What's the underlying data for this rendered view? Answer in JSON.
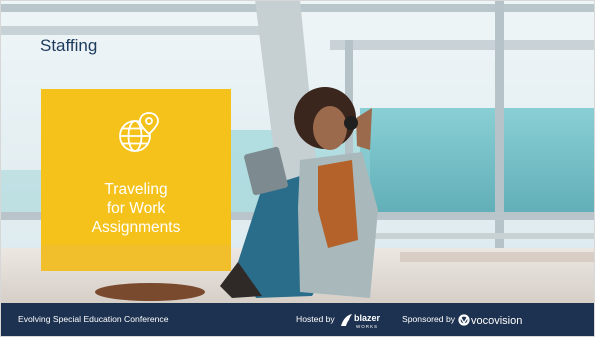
{
  "slide": {
    "title": "Staffing",
    "card": {
      "icon": "globe-location-pin-icon",
      "lines": [
        "Traveling",
        "for Work",
        "Assignments"
      ]
    }
  },
  "footer": {
    "conference": "Evolving Special Education Conference",
    "hosted_by": "Hosted by",
    "host_logo_text": "blazer",
    "host_logo_subtext": "WORKS",
    "sponsored_by": "Sponsored by",
    "sponsor_logo_text": "vocovision"
  },
  "colors": {
    "card": "#f4c21b",
    "title": "#1d3a5c",
    "footer": "#1d3250"
  }
}
